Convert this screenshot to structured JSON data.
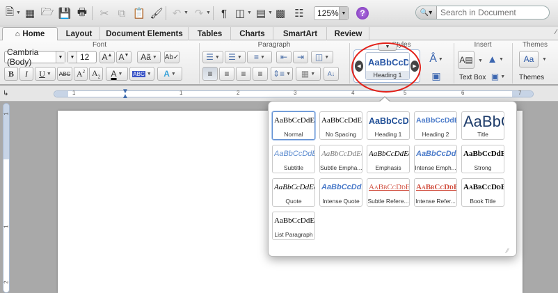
{
  "toolbar": {
    "zoom": "125%",
    "search_placeholder": "Search in Document"
  },
  "tabs": [
    {
      "label": "Home"
    },
    {
      "label": "Layout"
    },
    {
      "label": "Document Elements"
    },
    {
      "label": "Tables"
    },
    {
      "label": "Charts"
    },
    {
      "label": "SmartArt"
    },
    {
      "label": "Review"
    }
  ],
  "ribbon": {
    "groups": {
      "font": "Font",
      "paragraph": "Paragraph",
      "styles": "Styles",
      "insert": "Insert",
      "themes": "Themes"
    },
    "font_name": "Cambria (Body)",
    "font_size": "12",
    "gallery_sample": "AaBbCcDc",
    "gallery_name": "Heading 1",
    "insert_text_box": "Text Box",
    "themes_label": "Themes",
    "themes_sample": "Aa"
  },
  "ruler": {
    "numbers": [
      "1",
      "1",
      "2",
      "3",
      "4",
      "5",
      "6",
      "7"
    ],
    "vertical_numbers": [
      "1",
      "1",
      "2"
    ]
  },
  "styles_popup": {
    "rows": [
      [
        {
          "sample": "AaBbCcDdEe",
          "label": "Normal"
        },
        {
          "sample": "AaBbCcDdEe",
          "label": "No Spacing"
        },
        {
          "sample": "AaBbCcDc",
          "label": "Heading 1"
        },
        {
          "sample": "AaBbCcDdEe",
          "label": "Heading 2"
        },
        {
          "sample": "AaBbC",
          "label": "Title"
        }
      ],
      [
        {
          "sample": "AaBbCcDdE",
          "label": "Subtitle"
        },
        {
          "sample": "AaBbCcDdEe",
          "label": "Subtle Empha..."
        },
        {
          "sample": "AaBbCcDdEe",
          "label": "Emphasis"
        },
        {
          "sample": "AaBbCcDdE",
          "label": "Intense Emph..."
        },
        {
          "sample": "AaBbCcDdE",
          "label": "Strong"
        }
      ],
      [
        {
          "sample": "AaBbCcDdEe",
          "label": "Quote"
        },
        {
          "sample": "AaBbCcDdE",
          "label": "Intense Quote"
        },
        {
          "sample": "AaBbCcDdEe",
          "label": "Subtle Refere..."
        },
        {
          "sample": "AaBbCcDdEe",
          "label": "Intense Refer..."
        },
        {
          "sample": "AaBbCcDdEe",
          "label": "Book Title"
        }
      ],
      [
        {
          "sample": "AaBbCcDdEe",
          "label": "List Paragraph"
        }
      ]
    ]
  },
  "colors": {
    "accent_blue": "#2a58a6",
    "annotation_red": "#e32119"
  }
}
